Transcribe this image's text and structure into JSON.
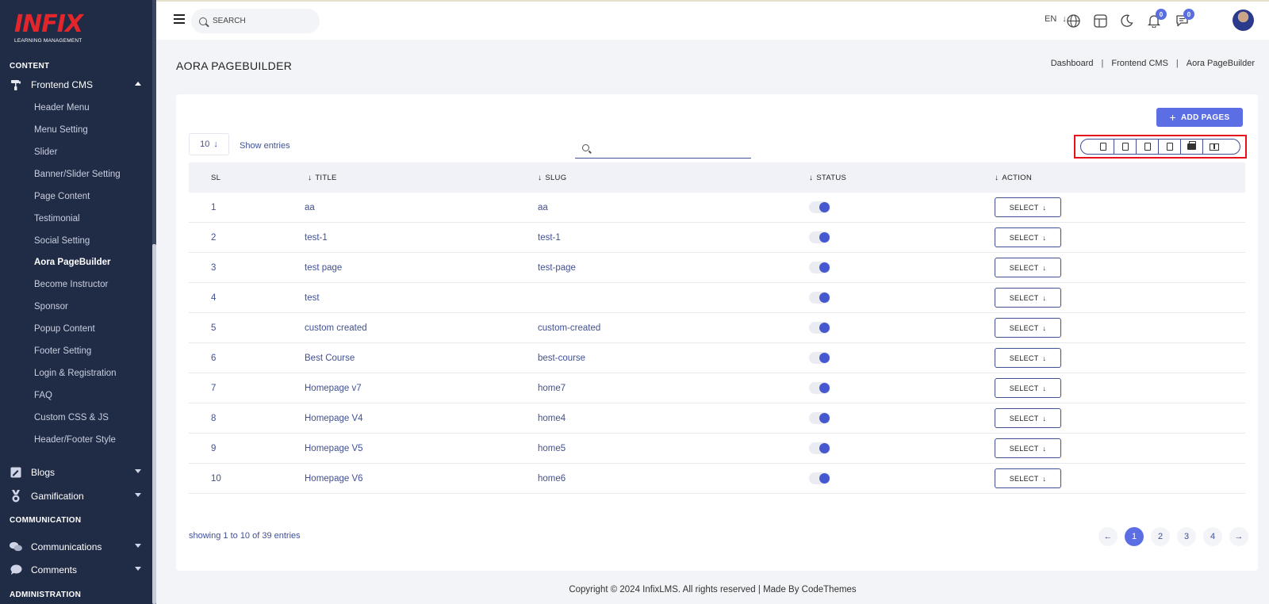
{
  "brand": {
    "logo_text": "INFIX",
    "logo_sub": "LEARNING MANAGEMENT"
  },
  "sidebar": {
    "section_content": "CONTENT",
    "frontend_cms": "Frontend CMS",
    "sub_items": [
      "Header Menu",
      "Menu Setting",
      "Slider",
      "Banner/Slider Setting",
      "Page Content",
      "Testimonial",
      "Social Setting",
      "Aora PageBuilder",
      "Become Instructor",
      "Sponsor",
      "Popup Content",
      "Footer Setting",
      "Login & Registration",
      "FAQ",
      "Custom CSS & JS",
      "Header/Footer Style"
    ],
    "blogs": "Blogs",
    "gamification": "Gamification",
    "section_communication": "COMMUNICATION",
    "communications": "Communications",
    "comments": "Comments",
    "section_administration": "ADMINISTRATION"
  },
  "topbar": {
    "search_placeholder": "SEARCH",
    "lang": "EN",
    "notifications_count": "0",
    "messages_count": "0"
  },
  "page": {
    "title": "AORA PAGEBUILDER",
    "breadcrumb": [
      "Dashboard",
      "Frontend CMS",
      "Aora PageBuilder"
    ]
  },
  "toolbar": {
    "add_label": "ADD PAGES",
    "entries_value": "10",
    "entries_label": "Show entries"
  },
  "table": {
    "headers": [
      "SL",
      "TITLE",
      "SLUG",
      "STATUS",
      "ACTION"
    ],
    "action_label": "SELECT",
    "rows": [
      {
        "sl": "1",
        "title": "aa",
        "slug": "aa"
      },
      {
        "sl": "2",
        "title": "test-1",
        "slug": "test-1"
      },
      {
        "sl": "3",
        "title": "test page",
        "slug": "test-page"
      },
      {
        "sl": "4",
        "title": "test",
        "slug": ""
      },
      {
        "sl": "5",
        "title": "custom created",
        "slug": "custom-created"
      },
      {
        "sl": "6",
        "title": "Best Course",
        "slug": "best-course"
      },
      {
        "sl": "7",
        "title": "Homepage v7",
        "slug": "home7"
      },
      {
        "sl": "8",
        "title": "Homepage V4",
        "slug": "home4"
      },
      {
        "sl": "9",
        "title": "Homepage V5",
        "slug": "home5"
      },
      {
        "sl": "10",
        "title": "Homepage V6",
        "slug": "home6"
      }
    ]
  },
  "pagination": {
    "showing": "showing 1 to 10 of 39 entries",
    "pages": [
      "1",
      "2",
      "3",
      "4"
    ]
  },
  "footer": "Copyright © 2024 InfixLMS. All rights reserved | Made By CodeThemes",
  "colors": {
    "sidebar_bg": "#202b45",
    "accent": "#5b6ee4",
    "brand_red": "#e3262b",
    "highlight": "#e8101a"
  }
}
